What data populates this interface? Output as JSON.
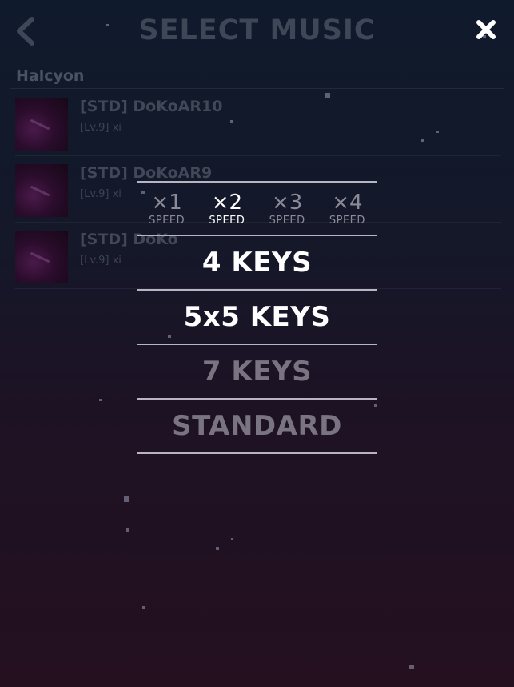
{
  "header": {
    "title": "SELECT MUSIC"
  },
  "section": {
    "title": "Halcyon"
  },
  "songs": [
    {
      "title": "[STD] DoKoAR10",
      "meta": "[Lv.9] xi"
    },
    {
      "title": "[STD] DoKoAR9",
      "meta": "[Lv.9] xi"
    },
    {
      "title": "[STD] DoKo",
      "meta": "[Lv.9] xi"
    }
  ],
  "speed": {
    "options": [
      {
        "value": "×1",
        "label": "SPEED"
      },
      {
        "value": "×2",
        "label": "SPEED"
      },
      {
        "value": "×3",
        "label": "SPEED"
      },
      {
        "value": "×4",
        "label": "SPEED"
      }
    ],
    "selected": "×2"
  },
  "modes": [
    {
      "label": "4 KEYS",
      "enabled": true
    },
    {
      "label": "5x5 KEYS",
      "enabled": true
    },
    {
      "label": "7 KEYS",
      "enabled": false
    },
    {
      "label": "STANDARD",
      "enabled": false
    }
  ],
  "colors": {
    "bg_top": "#0f1a2c",
    "bg_bottom": "#24101f",
    "text_active": "#ffffff",
    "text_dim": "#7a7482",
    "divider": "#b9b5c0"
  },
  "icons": {
    "back": "chevron-left-icon",
    "close": "close-icon"
  }
}
